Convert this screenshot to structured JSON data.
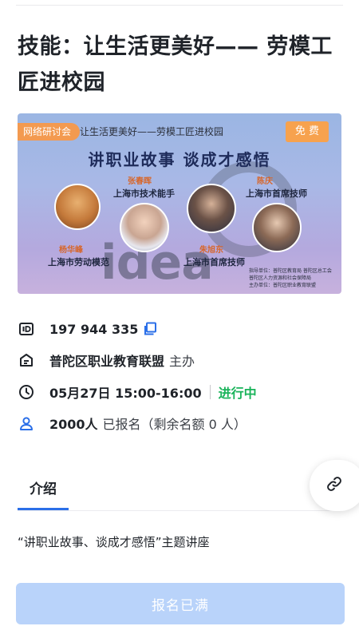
{
  "page": {
    "title": "技能：让生活更美好—— 劳模工匠进校园"
  },
  "banner": {
    "tag_left": "网络研讨会",
    "mini_title": "让生活更美好——劳模工匠进校园",
    "tag_free": "免 费",
    "headline": "讲职业故事  谈成才感悟",
    "watermark": "idea",
    "speakers": [
      {
        "name": "杨华峰",
        "role": "上海市劳动模范"
      },
      {
        "name": "张春晖",
        "role": "上海市技术能手"
      },
      {
        "name": "朱旭东",
        "role": "上海市首席技师"
      },
      {
        "name": "陈庆",
        "role": "上海市首席技师"
      }
    ],
    "sponsor_lines": [
      "指导单位：普陀区教育局  普陀区总工会",
      "普陀区人力资源和社会保障局",
      "主办单位：普陀区职业教育联盟"
    ]
  },
  "info": {
    "meeting_id": "197 944 335",
    "organizer": "普陀区职业教育联盟",
    "organizer_suffix": "主办",
    "datetime": "05月27日 15:00-16:00",
    "status": "进行中",
    "registered": "2000人",
    "registered_suffix": "已报名（剩余名额 0 人）"
  },
  "tabs": {
    "intro_label": "介绍"
  },
  "intro": {
    "text": "“讲职业故事、谈成才感悟”主题讲座"
  },
  "action": {
    "register_label": "报名已满"
  },
  "colors": {
    "accent": "#2b6fe8",
    "status_live": "#19b35a",
    "register_disabled": "#b9d3fa",
    "tag_orange": "#f39a50"
  },
  "icons": [
    "id-icon",
    "organizer-icon",
    "clock-icon",
    "user-icon",
    "copy-icon",
    "link-icon"
  ]
}
